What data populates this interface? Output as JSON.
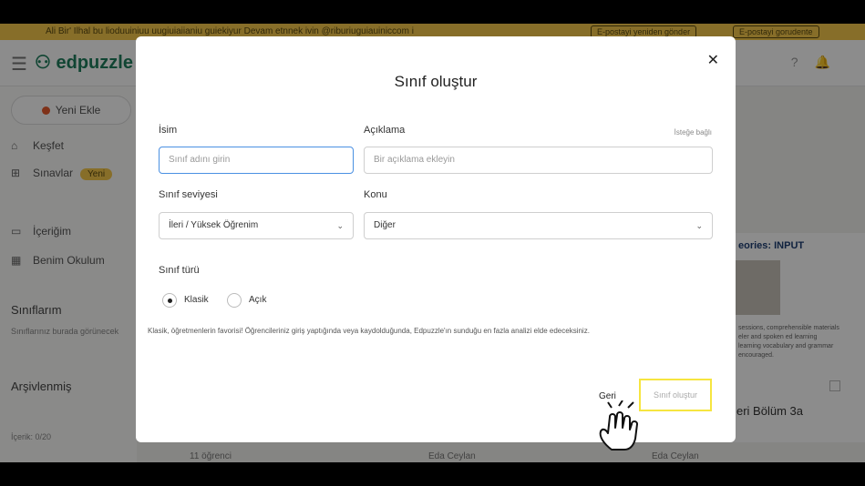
{
  "banner": {
    "text": "Ali Bir' Ilhal bu lioduuiniuu uugiuiaiianiu guiekiyur Devam etnnek ivin @riburiuguiauiniccom i",
    "btn_resend": "E-postayi yeniden gönder",
    "btn_fix": "E-postayi gorudente"
  },
  "header": {
    "logo": "edpuzzle"
  },
  "sidebar": {
    "add_button": "Yeni Ekle",
    "items": [
      {
        "label": "Keşfet"
      },
      {
        "label": "Sınavlar",
        "badge": "Yeni"
      },
      {
        "label": "İçeriğim"
      },
      {
        "label": "Benim Okulum"
      }
    ],
    "classes_heading": "Sınıflarım",
    "classes_hint": "Sınıflarınız burada görünecek",
    "archived_heading": "Arşivlenmiş",
    "content_count": "İçerik: 0/20"
  },
  "background": {
    "card_title": "eories: INPUT",
    "card_lines": [
      "sessions, comprehensible materials",
      "eler and spoken ed learning",
      "learning vocabulary and grammar",
      "encouraged."
    ],
    "lesson_title": "eri Bölüm 3a",
    "students": "11 öğrenci",
    "teacher1": "Eda Ceylan",
    "teacher2": "Eda Ceylan"
  },
  "modal": {
    "title": "Sınıf oluştur",
    "name_label": "İsim",
    "name_placeholder": "Sınıf adını girin",
    "desc_label": "Açıklama",
    "desc_optional": "İsteğe bağlı",
    "desc_placeholder": "Bir açıklama ekleyin",
    "level_label": "Sınıf seviyesi",
    "level_value": "İleri / Yüksek Öğrenim",
    "subject_label": "Konu",
    "subject_value": "Diğer",
    "type_label": "Sınıf türü",
    "type_classic": "Klasik",
    "type_open": "Açık",
    "description": "Klasik, öğretmenlerin favorisi! Öğrencileriniz giriş yaptığında veya kaydolduğunda, Edpuzzle'ın sunduğu en fazla analizi elde edeceksiniz.",
    "back_button": "Geri",
    "create_button": "Sınıf oluştur"
  }
}
